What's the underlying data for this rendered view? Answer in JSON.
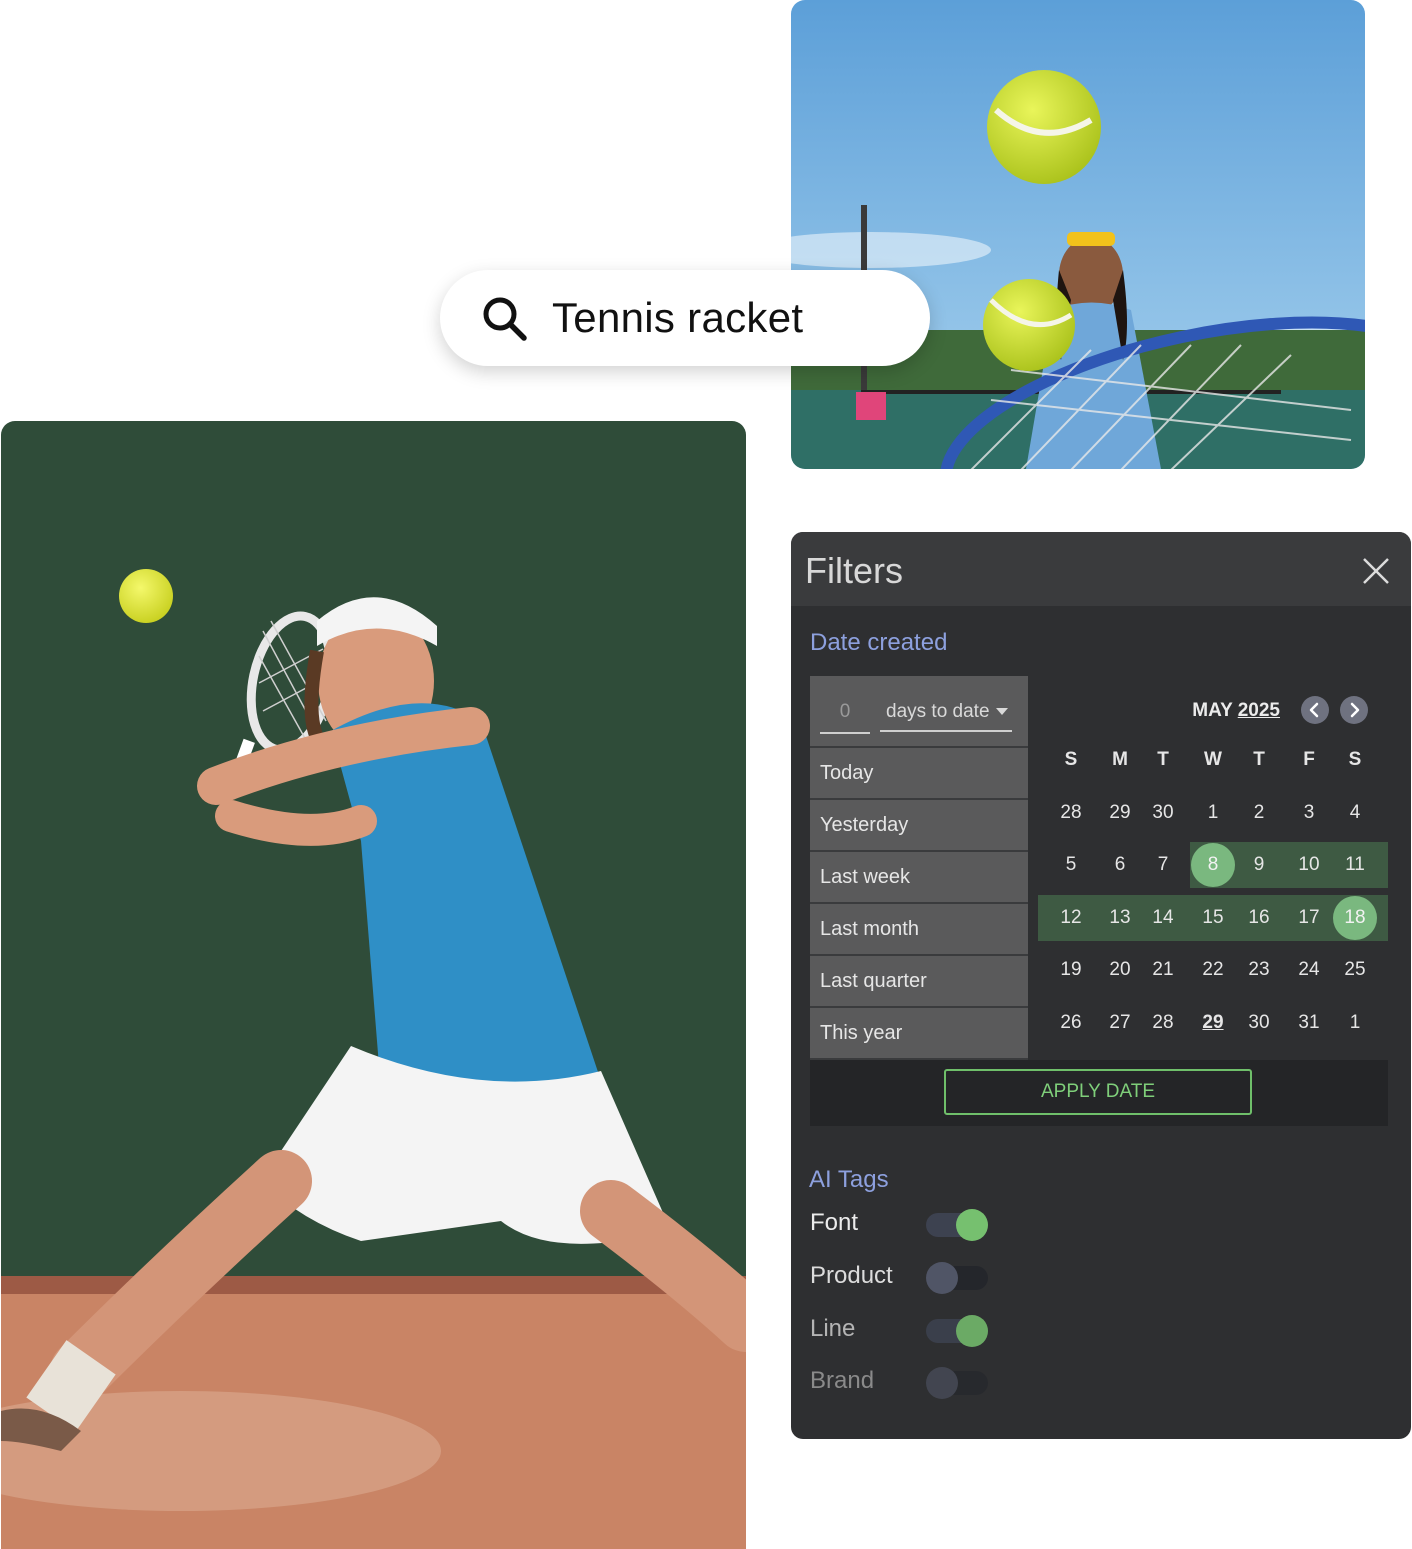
{
  "search": {
    "query": "Tennis racket",
    "icon": "search-icon"
  },
  "filters": {
    "title": "Filters",
    "date_section": {
      "title": "Date created",
      "range_number": "0",
      "range_unit": "days to date",
      "presets": [
        "Today",
        "Yesterday",
        "Last week",
        "Last month",
        "Last quarter",
        "This year"
      ]
    },
    "calendar": {
      "month": "MAY",
      "year": "2025",
      "weekdays": [
        "S",
        "M",
        "T",
        "W",
        "T",
        "F",
        "S"
      ],
      "weeks": [
        [
          "28",
          "29",
          "30",
          "1",
          "2",
          "3",
          "4"
        ],
        [
          "5",
          "6",
          "7",
          "8",
          "9",
          "10",
          "11"
        ],
        [
          "12",
          "13",
          "14",
          "15",
          "16",
          "17",
          "18"
        ],
        [
          "19",
          "20",
          "21",
          "22",
          "23",
          "24",
          "25"
        ],
        [
          "26",
          "27",
          "28",
          "29",
          "30",
          "31",
          "1"
        ]
      ],
      "range_start": "8",
      "range_end": "18",
      "today": "29"
    },
    "apply_label": "APPLY DATE",
    "ai_tags": {
      "title": "AI Tags",
      "items": [
        {
          "label": "Font",
          "on": true
        },
        {
          "label": "Product",
          "on": false
        },
        {
          "label": "Line",
          "on": true
        },
        {
          "label": "Brand",
          "on": false
        }
      ]
    }
  },
  "colors": {
    "accent_green": "#76c06f",
    "section_title": "#8da0de",
    "panel_bg": "#2e2f31"
  }
}
